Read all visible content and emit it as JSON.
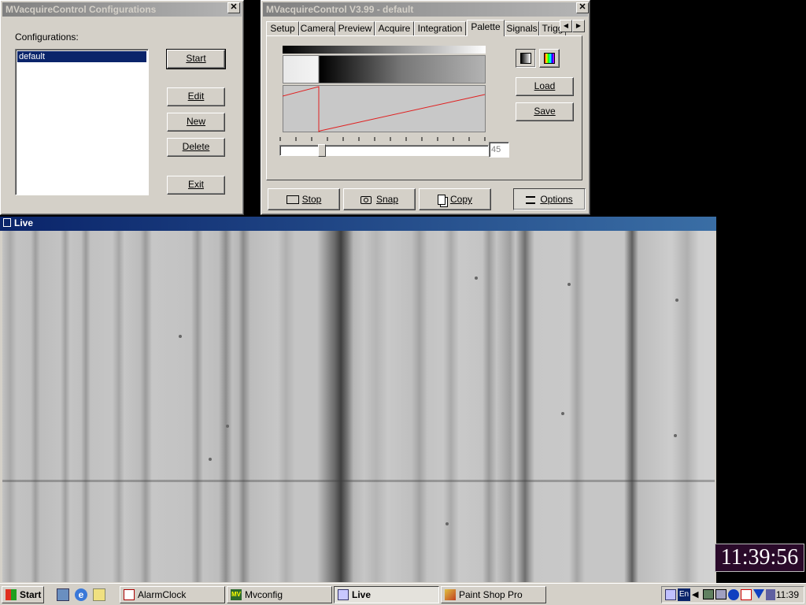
{
  "config_window": {
    "title": "MVacquireControl Configurations",
    "close": "✕",
    "label": "Configurations:",
    "list_items": [
      "default"
    ],
    "buttons": {
      "start": "Start",
      "edit": "Edit",
      "new": "New",
      "delete": "Delete",
      "exit": "Exit"
    }
  },
  "control_window": {
    "title": "MVacquireControl  V3.99 - default",
    "close": "✕",
    "tabs": [
      "Setup",
      "Camera",
      "Preview",
      "Acquire",
      "Integration",
      "Palette",
      "Signals",
      "Trigg"
    ],
    "active_tab": "Palette",
    "slider_value": "45",
    "slider_level": 0.19,
    "buttons": {
      "load": "Load",
      "save": "Save",
      "stop": "Stop",
      "snap": "Snap",
      "copy": "Copy",
      "options": "Options"
    },
    "icons": {
      "gray_palette": "grayscale-palette-icon",
      "color_palette": "color-palette-icon",
      "stop": "camera-stop-icon",
      "snap": "camera-snap-icon",
      "copy": "copy-icon",
      "options": "options-icon"
    },
    "curve_color": "#e02020"
  },
  "live_window": {
    "title": "Live"
  },
  "overlay_clock": "11:39:56",
  "taskbar": {
    "start": "Start",
    "tasks": [
      {
        "label": "AlarmClock",
        "pressed": false
      },
      {
        "label": "Mvconfig",
        "pressed": false
      },
      {
        "label": "Live",
        "pressed": true
      },
      {
        "label": "Paint Shop Pro",
        "pressed": false
      }
    ],
    "tray_time": "11:39",
    "tray_lang": "En"
  },
  "colors": {
    "active_title": "#0a246a",
    "inactive_title": "#808080",
    "face": "#d4d0c8",
    "desktop": "#000000",
    "clock_bg": "#2a0a2a"
  }
}
